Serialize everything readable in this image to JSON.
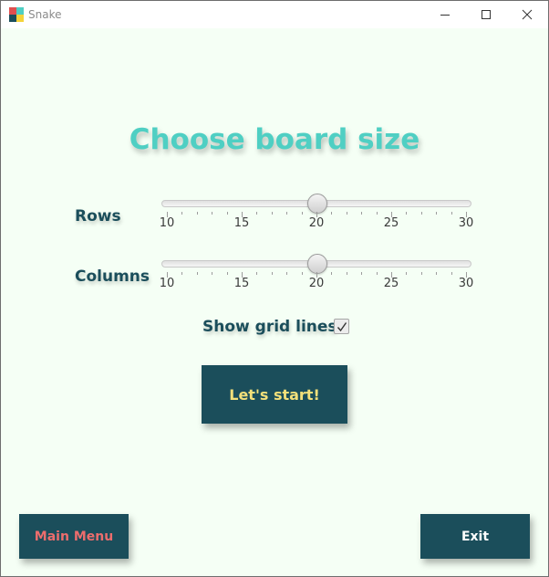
{
  "window": {
    "title": "Snake",
    "icon_colors": [
      "#e04f4f",
      "#4fcfc3",
      "#1b4e5b",
      "#f4d33a"
    ]
  },
  "main": {
    "heading": "Choose board size",
    "rows": {
      "label": "Rows",
      "min": 10,
      "max": 30,
      "value": 20,
      "tick_labels": [
        "10",
        "15",
        "20",
        "25",
        "30"
      ]
    },
    "columns": {
      "label": "Columns",
      "min": 10,
      "max": 30,
      "value": 20,
      "tick_labels": [
        "10",
        "15",
        "20",
        "25",
        "30"
      ]
    },
    "grid_lines": {
      "label": "Show grid lines",
      "checked": true
    },
    "start_label": "Let's start!"
  },
  "footer": {
    "main_menu_label": "Main Menu",
    "exit_label": "Exit"
  },
  "colors": {
    "background": "#f5fff5",
    "accent": "#4fcfc3",
    "button_bg": "#1b4e5b",
    "start_text": "#f4e07a",
    "menu_text": "#ec6d6d"
  }
}
